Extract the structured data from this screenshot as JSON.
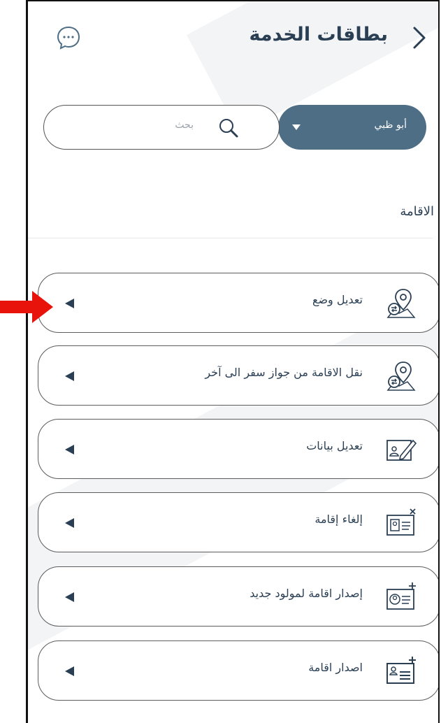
{
  "header": {
    "title": "بطاقات الخدمة"
  },
  "filters": {
    "emirate": "أبو ظبي",
    "search_placeholder": "بحث"
  },
  "section": {
    "title": "الاقامة"
  },
  "services": [
    {
      "label": "تعديل وضع",
      "icon": "map-pin-transfer-icon"
    },
    {
      "label": "نقل الاقامة من جواز سفر الى آخر",
      "icon": "map-pin-transfer-icon"
    },
    {
      "label": "تعديل بيانات",
      "icon": "id-card-edit-icon"
    },
    {
      "label": "إلغاء إقامة",
      "icon": "id-card-cancel-icon"
    },
    {
      "label": "إصدار اقامة لمولود جديد",
      "icon": "id-card-newborn-add-icon"
    },
    {
      "label": "اصدار اقامة",
      "icon": "id-card-add-icon"
    }
  ],
  "colors": {
    "accent": "#4e6e86",
    "text": "#2a3f54",
    "pointer": "#e8140c"
  }
}
